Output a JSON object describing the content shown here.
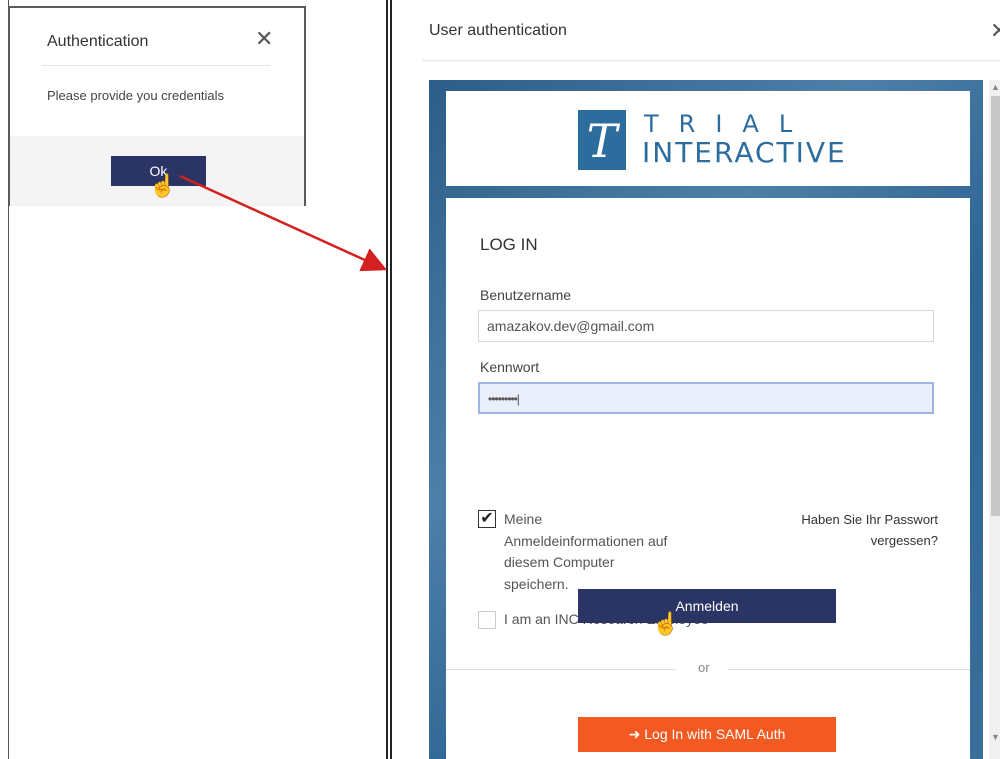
{
  "left_dialog": {
    "title": "Authentication",
    "close_glyph": "✕",
    "message": "Please provide you credentials",
    "ok_label": "Ok"
  },
  "right_dialog": {
    "title": "User authentication",
    "close_glyph": "✕",
    "logo": {
      "mark": "T",
      "line1": "TRIAL",
      "line2": "INTERACTIVE"
    },
    "form": {
      "heading": "LOG IN",
      "username_label": "Benutzername",
      "username_value": "amazakov.dev@gmail.com",
      "password_label": "Kennwort",
      "password_value": "•••••••••|",
      "remember": {
        "checked": true,
        "line1": "Meine",
        "line2": "Anmeldeinformationen auf",
        "line3": "diesem Computer",
        "line4": "speichern."
      },
      "forgot_line1": "Haben Sie Ihr Passwort",
      "forgot_line2": "vergessen?",
      "employee": {
        "checked": false,
        "label": "I am an INC Research Employee"
      },
      "submit_label": "Anmelden",
      "or_text": "or",
      "saml_label": "➜ Log In with SAML Auth"
    }
  },
  "colors": {
    "primary_button": "#2a3566",
    "saml_button": "#f25a22",
    "brand_blue": "#2d6d9e",
    "arrow": "#d42020"
  },
  "icons": {
    "cursor": "hand-pointer-icon",
    "close": "close-icon",
    "checkmark": "checkmark-icon",
    "login": "login-arrow-icon"
  }
}
